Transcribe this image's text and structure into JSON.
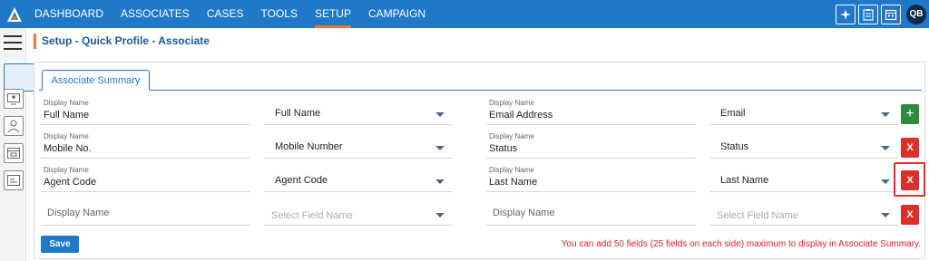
{
  "nav": {
    "items": [
      "DASHBOARD",
      "ASSOCIATES",
      "CASES",
      "TOOLS",
      "SETUP",
      "CAMPAIGN"
    ],
    "active": "SETUP"
  },
  "top_icons": [
    "sparkle-icon",
    "clipboard-icon",
    "calendar-icon"
  ],
  "user": {
    "initials": "QB"
  },
  "breadcrumb": "Setup - Quick Profile - Associate",
  "tab": "Associate Summary",
  "rows": [
    {
      "left": {
        "label": "Display Name",
        "display": "Full Name",
        "field": "Full Name"
      },
      "right": {
        "label": "Display Name",
        "display": "Email Address",
        "field": "Email"
      },
      "action": "+"
    },
    {
      "left": {
        "label": "Display Name",
        "display": "Mobile No.",
        "field": "Mobile Number"
      },
      "right": {
        "label": "Display Name",
        "display": "Status",
        "field": "Status"
      },
      "action": "X"
    },
    {
      "left": {
        "label": "Display Name",
        "display": "Agent Code",
        "field": "Agent Code"
      },
      "right": {
        "label": "Display Name",
        "display": "Last Name",
        "field": "Last Name"
      },
      "action": "X"
    }
  ],
  "empty_row": {
    "display_placeholder": "Display Name",
    "field_placeholder": "Select Field Name",
    "action": "X"
  },
  "save_label": "Save",
  "note": "You can add 50 fields (25 fields on each side) maximum to display in Associate Summary.",
  "colors": {
    "primary": "#1f78c8",
    "accent": "#f0762d",
    "add": "#2e8b3e",
    "delete": "#d9302b"
  }
}
